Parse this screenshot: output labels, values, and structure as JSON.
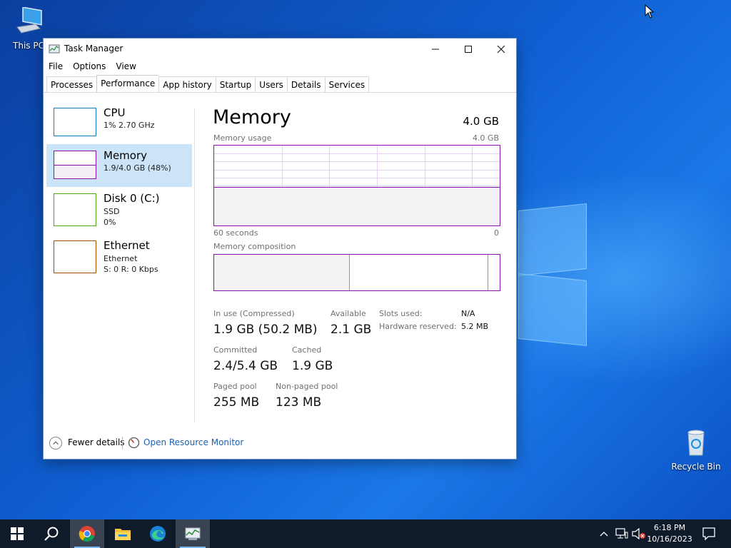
{
  "desktop": {
    "icons": [
      {
        "label": "This PC"
      },
      {
        "label": "Recycle Bin"
      }
    ]
  },
  "window": {
    "title": "Task Manager",
    "menu": [
      "File",
      "Options",
      "View"
    ],
    "tabs": [
      {
        "label": "Processes",
        "active": false
      },
      {
        "label": "Performance",
        "active": true
      },
      {
        "label": "App history",
        "active": false
      },
      {
        "label": "Startup",
        "active": false
      },
      {
        "label": "Users",
        "active": false
      },
      {
        "label": "Details",
        "active": false
      },
      {
        "label": "Services",
        "active": false
      }
    ]
  },
  "sidebar": {
    "items": [
      {
        "name": "CPU",
        "line1": "1%  2.70 GHz",
        "line2": "",
        "color": "#117dbb"
      },
      {
        "name": "Memory",
        "line1": "1.9/4.0 GB (48%)",
        "line2": "",
        "color": "#8b12ae",
        "selected": true
      },
      {
        "name": "Disk 0 (C:)",
        "line1": "SSD",
        "line2": "0%",
        "color": "#4da60c"
      },
      {
        "name": "Ethernet",
        "line1": "Ethernet",
        "line2": "S: 0  R: 0 Kbps",
        "color": "#a74f01"
      }
    ]
  },
  "memory": {
    "title": "Memory",
    "total": "4.0 GB",
    "usage_label": "Memory usage",
    "usage_max": "4.0 GB",
    "axis_left": "60 seconds",
    "axis_right": "0",
    "usage_fraction": 0.48,
    "composition_label": "Memory composition",
    "composition": {
      "in_use_fraction": 0.475,
      "modified_fraction": 0.485
    },
    "stats": {
      "in_use_label": "In use (Compressed)",
      "in_use_value": "1.9 GB (50.2 MB)",
      "available_label": "Available",
      "available_value": "2.1 GB",
      "committed_label": "Committed",
      "committed_value": "2.4/5.4 GB",
      "cached_label": "Cached",
      "cached_value": "1.9 GB",
      "paged_label": "Paged pool",
      "paged_value": "255 MB",
      "nonpaged_label": "Non-paged pool",
      "nonpaged_value": "123 MB",
      "slots_label": "Slots used:",
      "slots_value": "N/A",
      "reserved_label": "Hardware reserved:",
      "reserved_value": "5.2 MB"
    },
    "color": "#8b12ae"
  },
  "footer": {
    "fewer_details": "Fewer details",
    "open_resource_monitor": "Open Resource Monitor"
  },
  "taskbar": {
    "apps": [
      "start-icon",
      "search-icon",
      "chrome-icon",
      "file-explorer-icon",
      "edge-icon",
      "task-manager-icon"
    ],
    "time": "6:18 PM",
    "date": "10/16/2023"
  }
}
